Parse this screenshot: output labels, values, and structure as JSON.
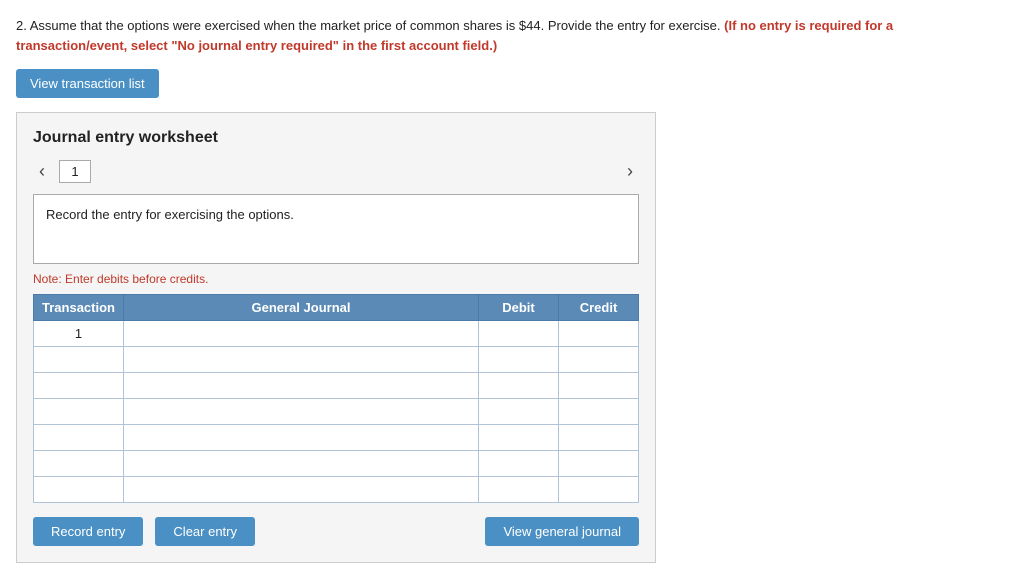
{
  "question": {
    "text": "2. Assume that the options were exercised when the market price of common shares is $44. Provide the entry for exercise.",
    "bold_red": "(If no entry is required for a transaction/event, select \"No journal entry required\" in the first account field.)"
  },
  "buttons": {
    "view_transaction": "View transaction list",
    "record_entry": "Record entry",
    "clear_entry": "Clear entry",
    "view_general_journal": "View general journal"
  },
  "worksheet": {
    "title": "Journal entry worksheet",
    "page_number": "1",
    "description": "Record the entry for exercising the options.",
    "note": "Note: Enter debits before credits.",
    "table": {
      "headers": {
        "transaction": "Transaction",
        "general_journal": "General Journal",
        "debit": "Debit",
        "credit": "Credit"
      },
      "rows": [
        {
          "transaction": "1",
          "general_journal": "",
          "debit": "",
          "credit": ""
        },
        {
          "transaction": "",
          "general_journal": "",
          "debit": "",
          "credit": ""
        },
        {
          "transaction": "",
          "general_journal": "",
          "debit": "",
          "credit": ""
        },
        {
          "transaction": "",
          "general_journal": "",
          "debit": "",
          "credit": ""
        },
        {
          "transaction": "",
          "general_journal": "",
          "debit": "",
          "credit": ""
        },
        {
          "transaction": "",
          "general_journal": "",
          "debit": "",
          "credit": ""
        },
        {
          "transaction": "",
          "general_journal": "",
          "debit": "",
          "credit": ""
        }
      ]
    }
  }
}
